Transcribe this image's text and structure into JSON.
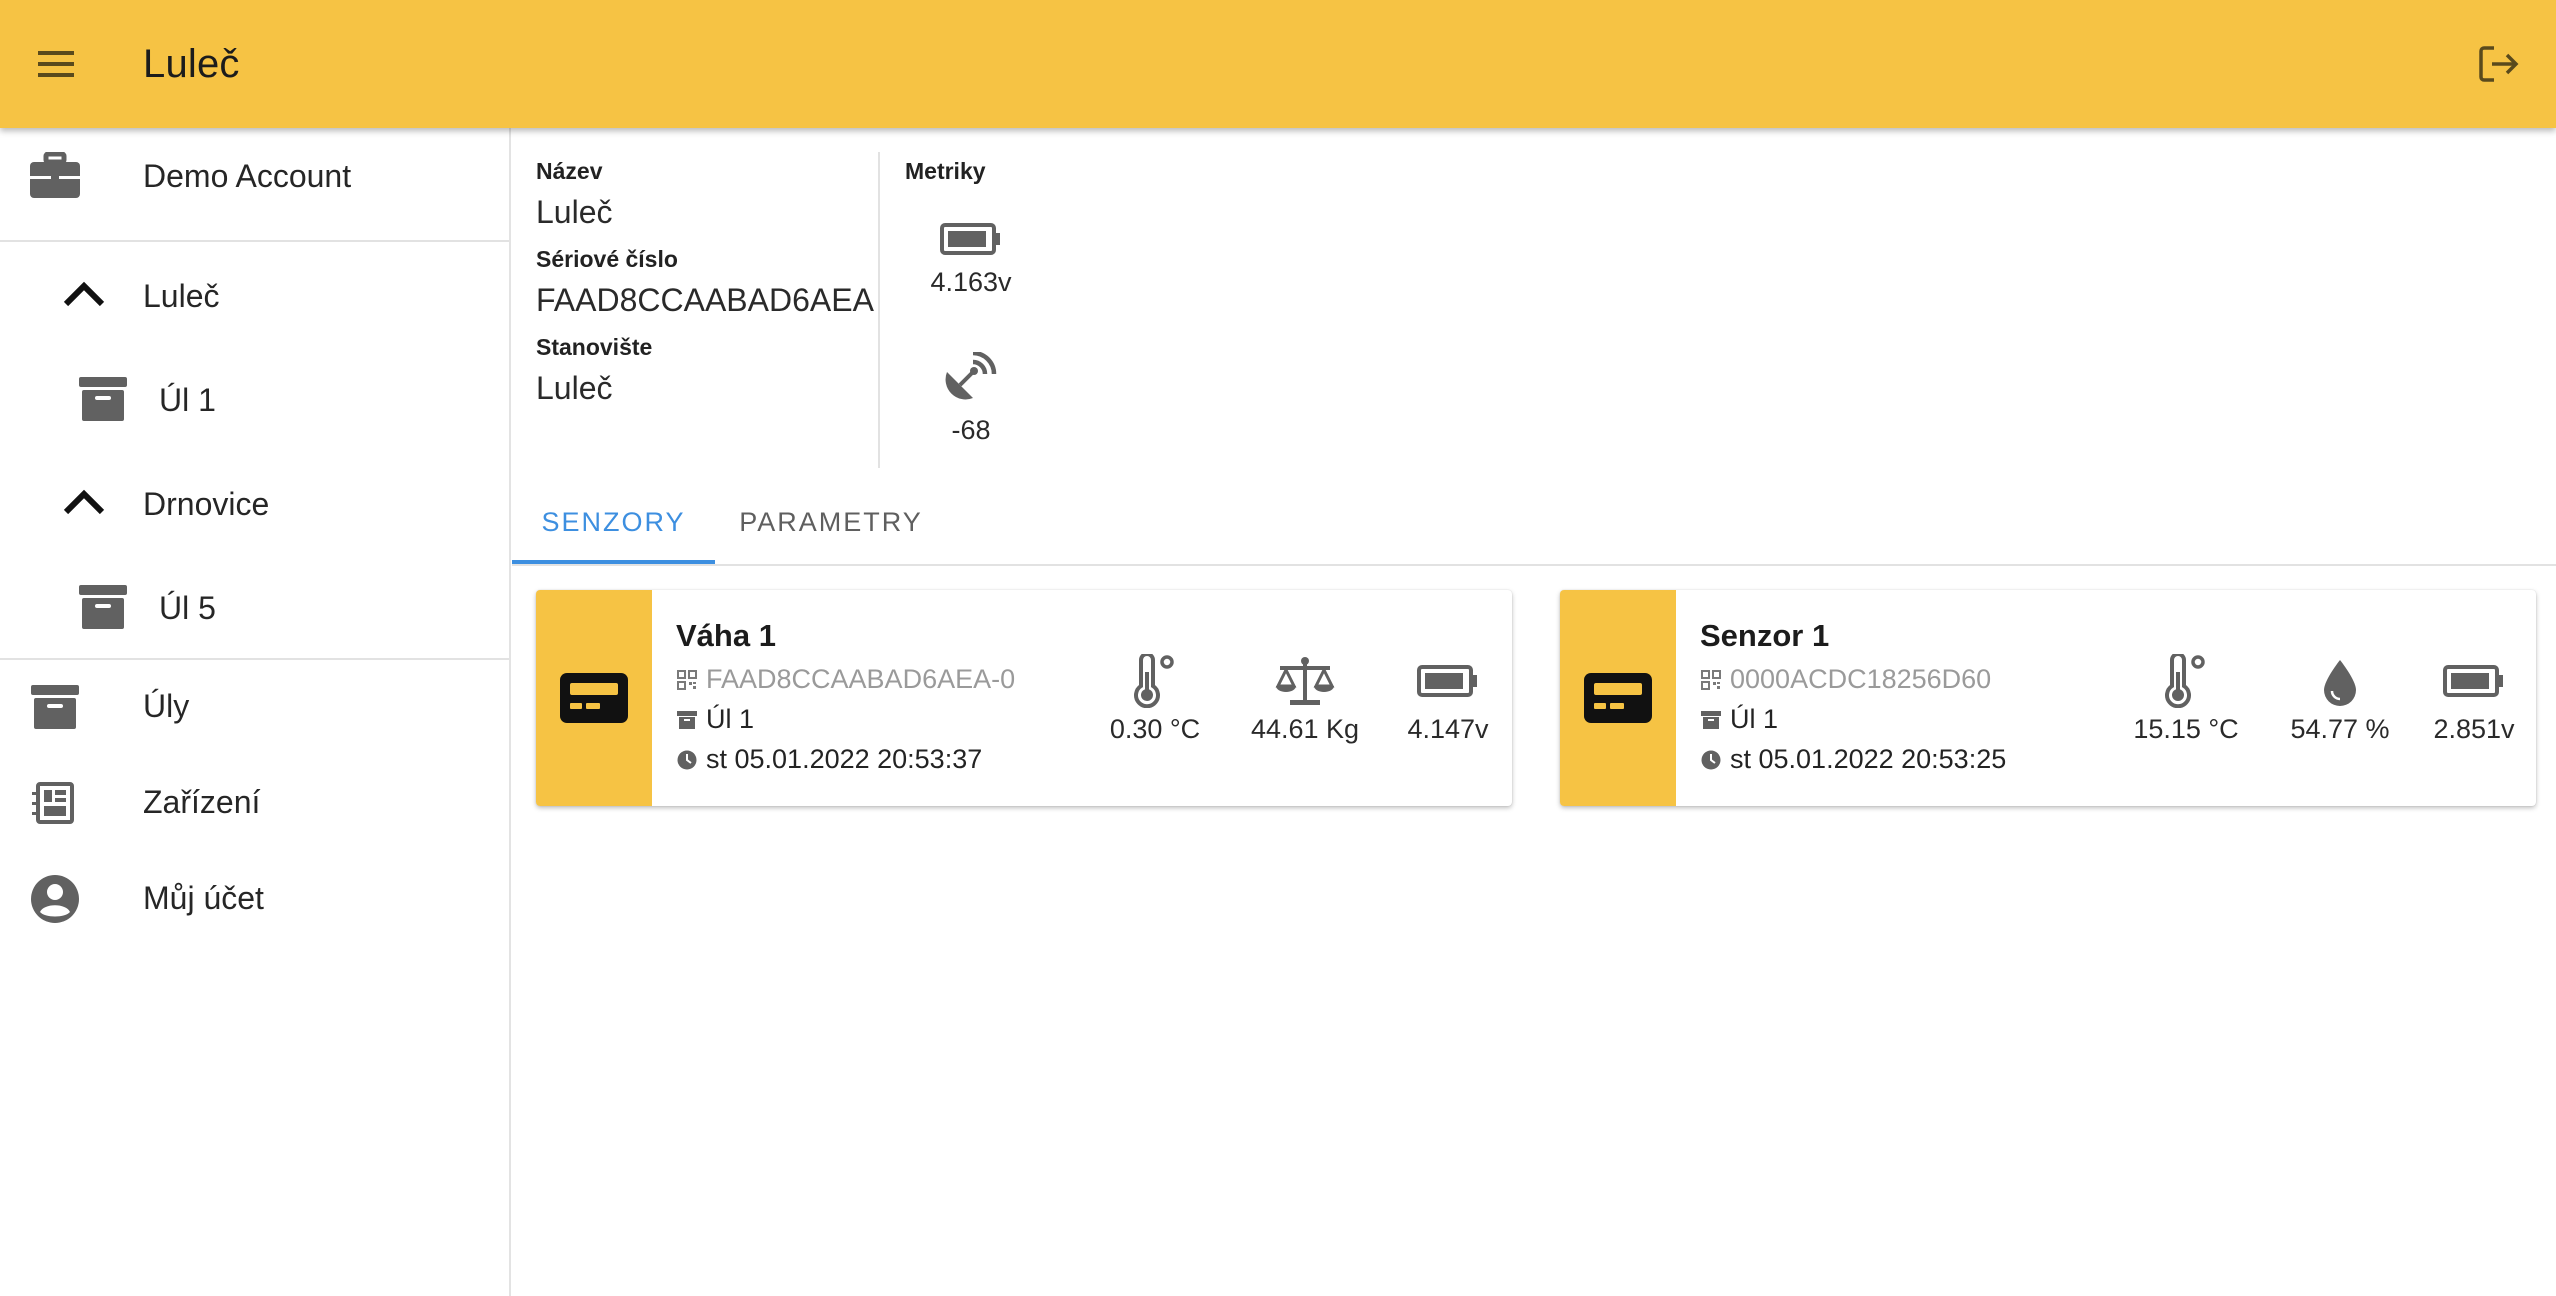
{
  "appbar": {
    "title": "Luleč",
    "color": "#f6c344"
  },
  "sidebar": {
    "account": "Demo Account",
    "groups": [
      {
        "label": "Luleč",
        "hives": [
          "Úl 1"
        ]
      },
      {
        "label": "Drnovice",
        "hives": [
          "Úl 5"
        ]
      }
    ],
    "items": [
      {
        "label": "Úly",
        "icon": "archive-icon"
      },
      {
        "label": "Zařízení",
        "icon": "device-icon"
      },
      {
        "label": "Můj účet",
        "icon": "account-circle-icon"
      }
    ]
  },
  "info": {
    "name_label": "Název",
    "name_value": "Luleč",
    "serial_label": "Sériové číslo",
    "serial_value": "FAAD8CCAABAD6AEA",
    "location_label": "Stanovište",
    "location_value": "Luleč",
    "metrics_label": "Metriky",
    "battery": "4.163v",
    "signal": "-68"
  },
  "tabs": [
    {
      "label": "SENZORY",
      "active": true
    },
    {
      "label": "PARAMETRY",
      "active": false
    }
  ],
  "accent_color": "#3d8fe0",
  "sensors": [
    {
      "name": "Váha 1",
      "serial": "FAAD8CCAABAD6AEA-0",
      "hive": "Úl 1",
      "timestamp": "st 05.01.2022 20:53:37",
      "metrics": [
        {
          "icon": "thermometer-icon",
          "value": "0.30 °C"
        },
        {
          "icon": "scale-icon",
          "value": "44.61 Kg"
        },
        {
          "icon": "battery-icon",
          "value": "4.147v"
        }
      ]
    },
    {
      "name": "Senzor 1",
      "serial": "0000ACDC18256D60",
      "hive": "Úl 1",
      "timestamp": "st 05.01.2022 20:53:25",
      "metrics": [
        {
          "icon": "thermometer-icon",
          "value": "15.15 °C"
        },
        {
          "icon": "humidity-drop-icon",
          "value": "54.77 %"
        },
        {
          "icon": "battery-icon",
          "value": "2.851v"
        }
      ]
    }
  ]
}
